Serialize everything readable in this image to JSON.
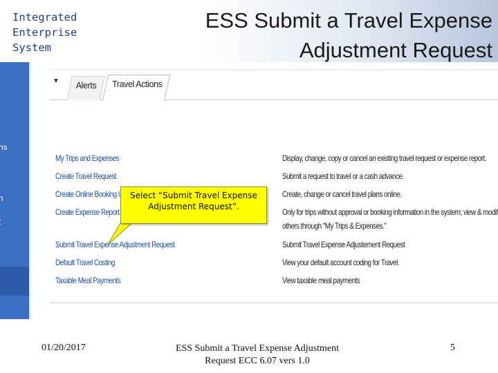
{
  "header": {
    "org_lines": [
      "Integrated",
      "Enterprise",
      "System"
    ],
    "title_lines": [
      "ESS Submit a Travel Expense",
      "Adjustment Request"
    ]
  },
  "left_nav": {
    "fragments": [
      "ns",
      "n",
      "t"
    ]
  },
  "tabs": [
    {
      "label": "Alerts",
      "active": false
    },
    {
      "label": "Travel Actions",
      "active": true
    }
  ],
  "actions": [
    {
      "link": "My Trips and Expenses",
      "description": "Display, change, copy or cancel an existing travel request or expense report."
    },
    {
      "link": "Create Travel Request",
      "description": "Submit a request to travel or a cash advance."
    },
    {
      "link": "Create Online Booking Using",
      "description": "Create, change or cancel travel plans online."
    },
    {
      "link": "Create Expense Report",
      "description": "Only for trips without approval or booking information in the system; view & modify all"
    },
    {
      "link": "",
      "description": "others through \"My Trips & Expenses.\""
    },
    {
      "link": "Submit Travel Expense Adjustment Request",
      "description": "Submit Travel Expense Adjustement Request"
    },
    {
      "link": "Default Travel Costing",
      "description": "View your default account coding for Travel."
    },
    {
      "link": "Taxable Meal Payments",
      "description": "View taxable meal payments"
    }
  ],
  "callout": {
    "lines": [
      "Select “Submit Travel Expense",
      "Adjustment Request”."
    ],
    "color": "#ffff00"
  },
  "footer": {
    "date": "01/20/2017",
    "center_lines": [
      "ESS Submit a Travel Expense Adjustment",
      "Request ECC 6.07 vers 1.0"
    ],
    "page_number": "5"
  },
  "colors": {
    "nav_bar": "#3b6fc4",
    "link": "#1b4fa6"
  }
}
